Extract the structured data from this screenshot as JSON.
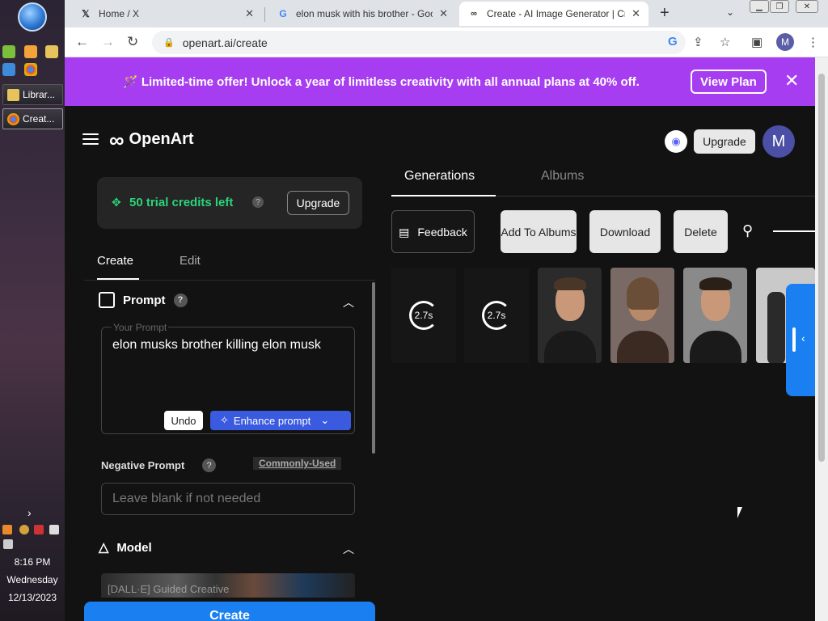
{
  "taskbar": {
    "tasks": [
      {
        "label": "Librar..."
      },
      {
        "label": "Creat..."
      }
    ],
    "clock": {
      "time": "8:16 PM",
      "day": "Wednesday",
      "date": "12/13/2023"
    }
  },
  "browser": {
    "tabs": [
      {
        "title": "Home / X",
        "favicon": "x-logo-icon"
      },
      {
        "title": "elon musk with his brother - Goo",
        "favicon": "google-icon"
      },
      {
        "title": "Create - AI Image Generator | Cr",
        "favicon": "openart-icon"
      }
    ],
    "url": "openart.ai/create",
    "profile_initial": "M"
  },
  "promo": {
    "text": "🪄 Limited-time offer! Unlock a year of limitless creativity with all annual plans at 40% off.",
    "button": "View Plan",
    "color": "#a73df0"
  },
  "header": {
    "logo_text": "OpenArt",
    "upgrade_label": "Upgrade",
    "avatar_initial": "M"
  },
  "credits": {
    "text": "50 trial credits left",
    "upgrade_label": "Upgrade",
    "color": "#2bd47a"
  },
  "left_tabs": {
    "create": "Create",
    "edit": "Edit"
  },
  "prompt": {
    "heading": "Prompt",
    "field_label": "Your Prompt",
    "value": "elon musks brother killing elon musk",
    "undo_label": "Undo",
    "enhance_label": "Enhance prompt"
  },
  "negative_prompt": {
    "heading": "Negative Prompt",
    "commonly_used": "Commonly-Used",
    "placeholder": "Leave blank if not needed"
  },
  "model": {
    "heading": "Model",
    "preview_text": "[DALL·E] Guided Creative"
  },
  "create_button": "Create",
  "right_tabs": {
    "generations": "Generations",
    "albums": "Albums"
  },
  "actions": {
    "feedback": "Feedback",
    "add_to_albums": "Add To Albums",
    "download": "Download",
    "delete": "Delete"
  },
  "generations": {
    "loaders": [
      "2.7s",
      "2.7s"
    ],
    "thumbnails": [
      {
        "bg": "#2b2b2b"
      },
      {
        "bg": "#7a6a66"
      },
      {
        "bg": "#8a8a8a"
      },
      {
        "bg": "#c9c9c9"
      }
    ]
  },
  "accent_color": "#1a7ff0"
}
